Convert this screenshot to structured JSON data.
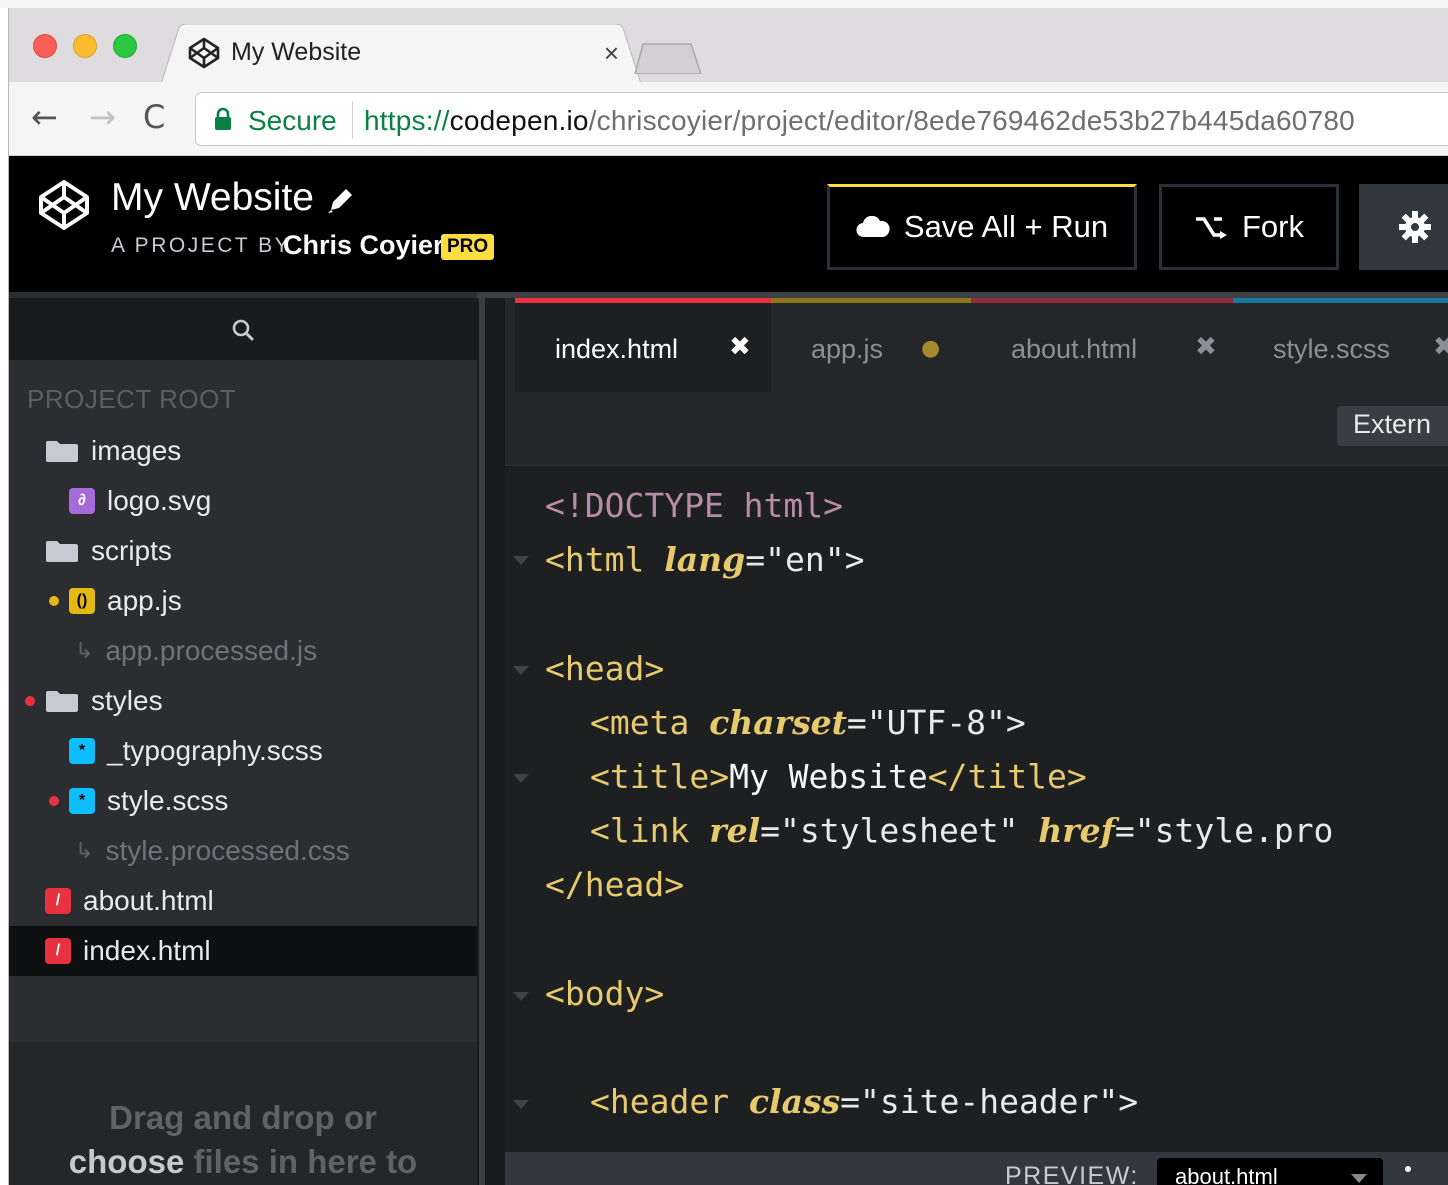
{
  "browser": {
    "tab_title": "My Website",
    "tab_close": "×",
    "secure_label": "Secure",
    "url_scheme": "https://",
    "url_host": "codepen.io",
    "url_path": "/chriscoyier/project/editor/8ede769462de53b27b445da60780"
  },
  "header": {
    "project_title": "My Website",
    "project_by": "A PROJECT BY",
    "author": "Chris Coyier",
    "pro_badge": "PRO",
    "save_button": "Save All + Run",
    "fork_button": "Fork"
  },
  "sidebar": {
    "section_label": "PROJECT ROOT",
    "files": [
      {
        "name": "images",
        "kind": "folder",
        "indent": 0,
        "dot": null
      },
      {
        "name": "logo.svg",
        "kind": "svg",
        "indent": 1,
        "dot": null
      },
      {
        "name": "scripts",
        "kind": "folder",
        "indent": 0,
        "dot": null
      },
      {
        "name": "app.js",
        "kind": "js",
        "indent": 1,
        "dot": "#e5b913"
      },
      {
        "name": "app.processed.js",
        "kind": "processed",
        "indent": 2,
        "dot": null
      },
      {
        "name": "styles",
        "kind": "folder",
        "indent": 0,
        "dot": "#e8323f"
      },
      {
        "name": "_typography.scss",
        "kind": "scss",
        "indent": 1,
        "dot": null
      },
      {
        "name": "style.scss",
        "kind": "scss",
        "indent": 1,
        "dot": "#e8323f"
      },
      {
        "name": "style.processed.css",
        "kind": "processed",
        "indent": 2,
        "dot": null
      },
      {
        "name": "about.html",
        "kind": "html",
        "indent": 0,
        "dot": null
      },
      {
        "name": "index.html",
        "kind": "html",
        "indent": 0,
        "dot": null,
        "selected": true
      }
    ],
    "drop_line1": "Drag and drop or",
    "drop_choose": "choose",
    "drop_line2_rest": " files in here to"
  },
  "editor": {
    "tabs": [
      {
        "label": "index.html",
        "close": "✖",
        "active": true,
        "color": "#e8323f"
      },
      {
        "label": "app.js",
        "close": "●",
        "active": false,
        "color": "#e5b913"
      },
      {
        "label": "about.html",
        "close": "✖",
        "active": false,
        "color": "#e8323f"
      },
      {
        "label": "style.scss",
        "close": "✖",
        "active": false,
        "color": "#0ebeff"
      }
    ],
    "external_button": "Extern",
    "preview_label": "PREVIEW:",
    "preview_selected": "about.html"
  },
  "code": {
    "doctype": "<!DOCTYPE html>",
    "html_open": "<html ",
    "lang_attr": "lang",
    "lang_val": "\"en\">",
    "head_open": "<head>",
    "meta_open": "<meta ",
    "charset_attr": "charset",
    "charset_val": "\"UTF-8\">",
    "title_open": "<title>",
    "title_text": "My Website",
    "title_close": "</title>",
    "link_open": "<link ",
    "rel_attr": "rel",
    "rel_val": "\"stylesheet\" ",
    "href_attr": "href",
    "href_val": "\"style.pro",
    "head_close": "</head>",
    "body_open": "<body>",
    "header_open": "<header ",
    "class_attr": "class",
    "class_val": "\"site-header\">",
    "eq": "="
  },
  "colors": {
    "codepen_yellow": "#ffdd40",
    "html_red": "#e8323f",
    "js_yellow": "#e5b913",
    "scss_blue": "#0ebeff",
    "secure_green": "#0b8043"
  }
}
